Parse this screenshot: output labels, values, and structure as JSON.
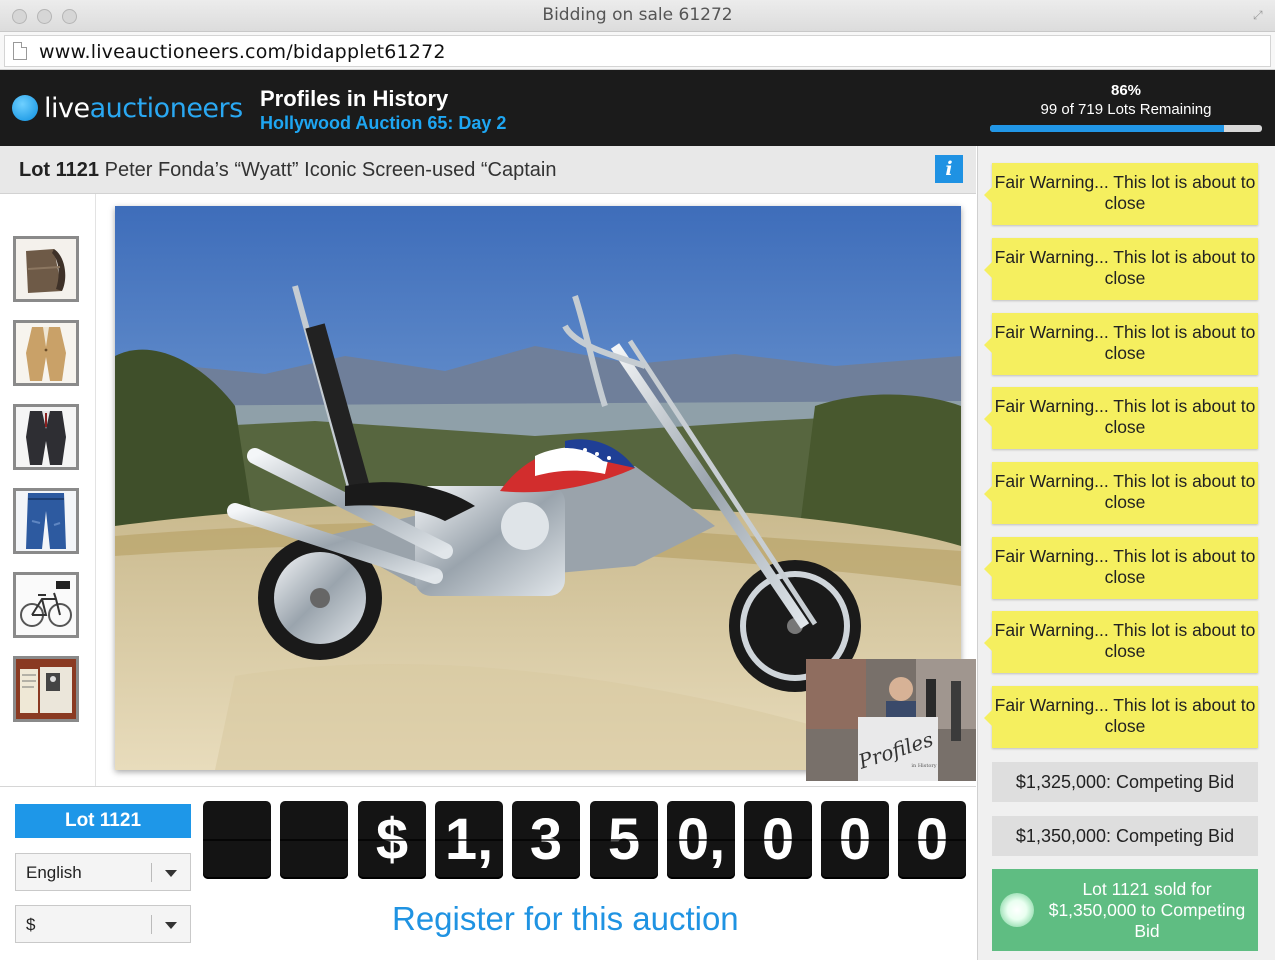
{
  "window": {
    "title": "Bidding on sale 61272"
  },
  "browser": {
    "url": "www.liveauctioneers.com/bidapplet61272"
  },
  "header": {
    "logo_live": "live",
    "logo_auctioneers": "auctioneers",
    "house_name": "Profiles in History",
    "sale_name": "Hollywood Auction 65: Day 2",
    "progress_percent": "86%",
    "progress_fraction": 0.86,
    "lots_remaining": "99 of 719 Lots Remaining"
  },
  "lot": {
    "number_label": "Lot 1121",
    "title": "Peter Fonda’s “Wyatt” Iconic Screen-used “Captain",
    "info_icon": "info-icon"
  },
  "thumbnails": [
    {
      "name": "thumb-hat"
    },
    {
      "name": "thumb-tan-suit"
    },
    {
      "name": "thumb-dark-suit"
    },
    {
      "name": "thumb-jeans"
    },
    {
      "name": "thumb-bicycle"
    },
    {
      "name": "thumb-document"
    }
  ],
  "feed": {
    "warnings": [
      "Fair Warning... This lot is about to close",
      "Fair Warning... This lot is about to close",
      "Fair Warning... This lot is about to close",
      "Fair Warning... This lot is about to close",
      "Fair Warning... This lot is about to close",
      "Fair Warning... This lot is about to close",
      "Fair Warning... This lot is about to close",
      "Fair Warning... This lot is about to close"
    ],
    "bids": [
      "$1,325,000: Competing Bid",
      "$1,350,000: Competing Bid"
    ],
    "sold_message": "Lot 1121 sold for $1,350,000 to Competing Bid"
  },
  "controls": {
    "lot_button": "Lot 1121",
    "language": "English",
    "currency": "$",
    "price_digits": [
      "",
      "",
      "$",
      "1,",
      "3",
      "5",
      "0,",
      "0",
      "0",
      "0"
    ],
    "register_link": "Register for this auction"
  },
  "colors": {
    "brand_blue": "#1e97e8",
    "header_bg": "#1b1b1b",
    "warning_yellow": "#f5ef5f",
    "sold_green": "#5fbd82"
  }
}
